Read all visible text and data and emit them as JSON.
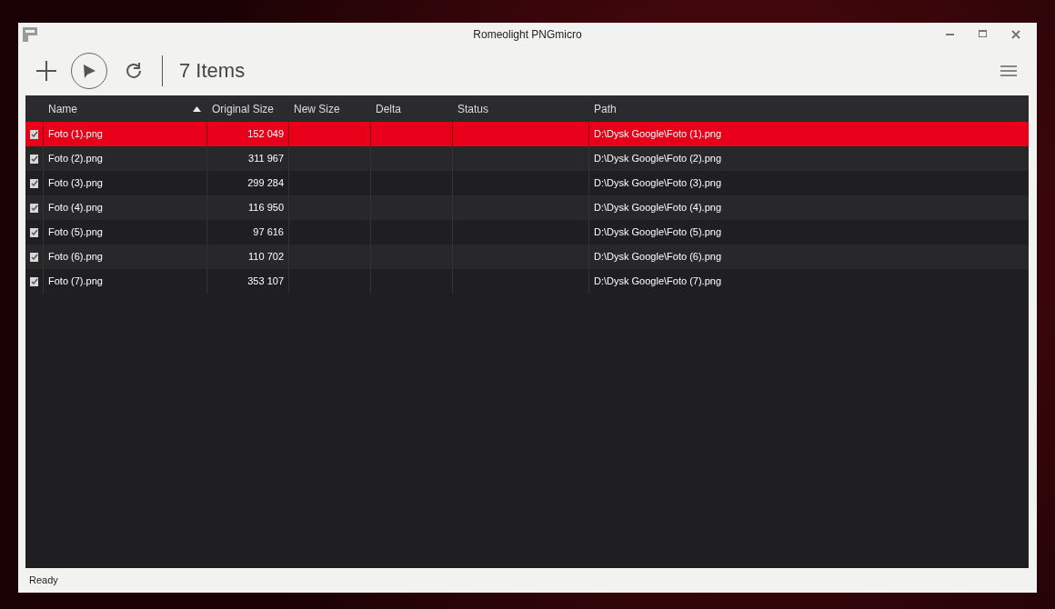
{
  "window": {
    "title": "Romeolight PNGmicro"
  },
  "toolbar": {
    "item_count": "7 Items"
  },
  "table": {
    "columns": [
      {
        "label": "Name",
        "sorted": true
      },
      {
        "label": "Original Size",
        "sorted": false
      },
      {
        "label": "New Size",
        "sorted": false
      },
      {
        "label": "Delta",
        "sorted": false
      },
      {
        "label": "Status",
        "sorted": false
      },
      {
        "label": "Path",
        "sorted": false
      }
    ],
    "rows": [
      {
        "checked": true,
        "selected": true,
        "name": "Foto (1).png",
        "original_size": "152 049",
        "path": "D:\\Dysk Google\\Foto (1).png"
      },
      {
        "checked": true,
        "selected": false,
        "name": "Foto (2).png",
        "original_size": "311 967",
        "path": "D:\\Dysk Google\\Foto (2).png"
      },
      {
        "checked": true,
        "selected": false,
        "name": "Foto (3).png",
        "original_size": "299 284",
        "path": "D:\\Dysk Google\\Foto (3).png"
      },
      {
        "checked": true,
        "selected": false,
        "name": "Foto (4).png",
        "original_size": "116 950",
        "path": "D:\\Dysk Google\\Foto (4).png"
      },
      {
        "checked": true,
        "selected": false,
        "name": "Foto (5).png",
        "original_size": "97 616",
        "path": "D:\\Dysk Google\\Foto (5).png"
      },
      {
        "checked": true,
        "selected": false,
        "name": "Foto (6).png",
        "original_size": "110 702",
        "path": "D:\\Dysk Google\\Foto (6).png"
      },
      {
        "checked": true,
        "selected": false,
        "name": "Foto (7).png",
        "original_size": "353 107",
        "path": "D:\\Dysk Google\\Foto (7).png"
      }
    ]
  },
  "status_bar": {
    "text": "Ready"
  }
}
